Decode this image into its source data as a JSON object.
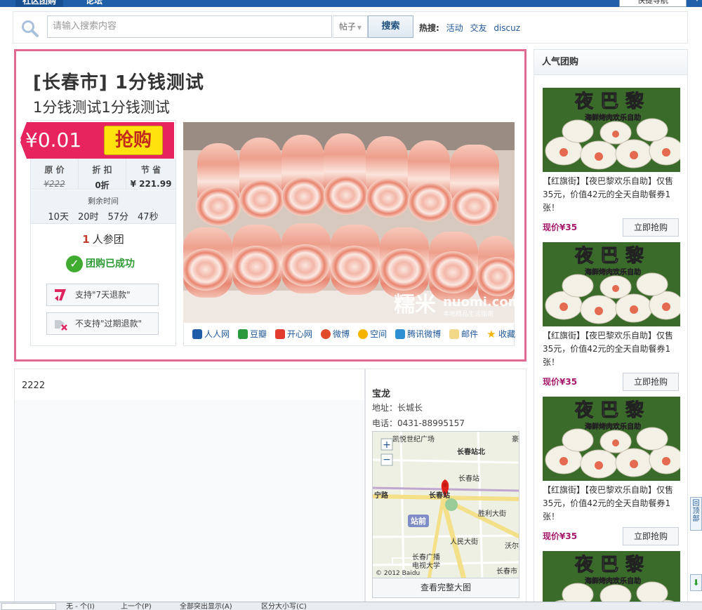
{
  "nav": {
    "tabs": [
      "社区团购",
      "论坛"
    ],
    "quick_nav": "快捷导航"
  },
  "search": {
    "placeholder": "请输入搜索内容",
    "type": "帖子",
    "button": "搜索",
    "hot_label": "热搜:",
    "hot_links": [
      "活动",
      "交友",
      "discuz"
    ]
  },
  "deal": {
    "title": "[长春市] 1分钱测试",
    "subtitle": "1分钱测试1分钱测试",
    "price": "¥0.01",
    "buy_label": "抢购",
    "stats": [
      {
        "label": "原 价",
        "value": "¥222"
      },
      {
        "label": "折 扣",
        "value": "0折"
      },
      {
        "label": "节 省",
        "value": "¥ 221.99"
      }
    ],
    "countdown_label": "剩余时间",
    "countdown": "10天　20时　57分　47秒",
    "participants_num": "1",
    "participants_label": "人参团",
    "status": "团购已成功",
    "refund_7day": "支持\"7天退款\"",
    "refund_expired": "不支持\"过期退款\"",
    "image_watermark": "糯米",
    "image_watermark_en": "nuomi.com",
    "image_watermark_sub": "本地精品生活指南",
    "share": [
      "人人网",
      "豆瓣",
      "开心网",
      "微博",
      "空间",
      "腾讯微博",
      "邮件",
      "收藏"
    ]
  },
  "description": {
    "text": "2222"
  },
  "store": {
    "name": "宝龙",
    "address": "地址：长城长",
    "phone": "电话：0431-88995157",
    "map_link": "查看完整大图",
    "map_labels": {
      "l1": "凯悦世纪广场",
      "l2": "长春站北",
      "l3": "长春站",
      "l4": "宁路",
      "l5": "长春站",
      "l6": "站前",
      "l7": "胜利大街",
      "l8": "人民大街",
      "l9": "长春广播",
      "l10": "电视大学",
      "l11": "沃尔",
      "l12": "长春市",
      "l13": "豪",
      "copyright": "© 2012 Baidu"
    }
  },
  "sidebar": {
    "title": "人气团购",
    "img_text": "夜巴黎",
    "img_sub": "海鲜烤肉欢乐自助",
    "items": [
      {
        "title": "【红旗街】【夜巴黎欢乐自助】仅售35元，价值42元的全天自助餐券1张！",
        "price": "现价¥35",
        "button": "立即抢购"
      },
      {
        "title": "【红旗街】【夜巴黎欢乐自助】仅售35元，价值42元的全天自助餐券1张！",
        "price": "现价¥35",
        "button": "立即抢购"
      },
      {
        "title": "【红旗街】【夜巴黎欢乐自助】仅售35元，价值42元的全天自助餐券1张！",
        "price": "现价¥35",
        "button": "立即抢购"
      }
    ]
  },
  "back_to_top": "回顶部",
  "statusbar": {
    "items": [
      "无 - 个(I)",
      "上一个(P)",
      "全部突出显示(A)",
      "区分大小写(C)"
    ]
  },
  "colors": {
    "accent": "#e06a90",
    "price_tag": "#e8245e",
    "buy_button": "#ffe20e",
    "nav": "#2060a8",
    "link": "#1f5899"
  }
}
